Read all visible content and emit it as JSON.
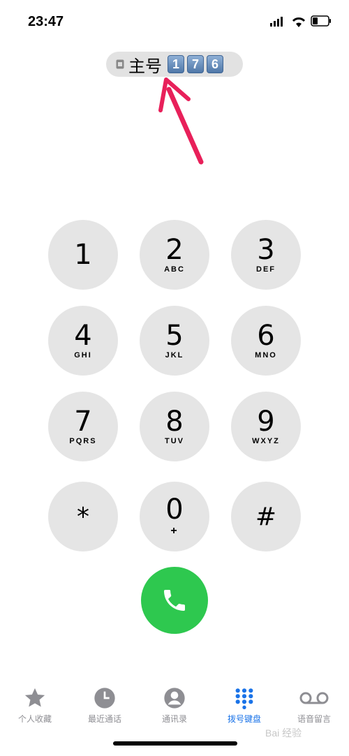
{
  "status": {
    "time": "23:47"
  },
  "sim": {
    "label": "主号",
    "digits": [
      "1",
      "7",
      "6"
    ]
  },
  "keypad": {
    "keys": [
      {
        "digit": "1",
        "letters": ""
      },
      {
        "digit": "2",
        "letters": "ABC"
      },
      {
        "digit": "3",
        "letters": "DEF"
      },
      {
        "digit": "4",
        "letters": "GHI"
      },
      {
        "digit": "5",
        "letters": "JKL"
      },
      {
        "digit": "6",
        "letters": "MNO"
      },
      {
        "digit": "7",
        "letters": "PQRS"
      },
      {
        "digit": "8",
        "letters": "TUV"
      },
      {
        "digit": "9",
        "letters": "WXYZ"
      },
      {
        "digit": "*",
        "letters": ""
      },
      {
        "digit": "0",
        "letters": "+"
      },
      {
        "digit": "#",
        "letters": ""
      }
    ]
  },
  "tabs": [
    {
      "label": "个人收藏",
      "icon": "star-icon"
    },
    {
      "label": "最近通话",
      "icon": "clock-icon"
    },
    {
      "label": "通讯录",
      "icon": "contact-icon"
    },
    {
      "label": "拨号键盘",
      "icon": "keypad-icon",
      "active": true
    },
    {
      "label": "语音留言",
      "icon": "voicemail-icon"
    }
  ],
  "colors": {
    "accent": "#1a73e8",
    "call": "#2ec84f",
    "key": "#e5e5e5",
    "arrow": "#e8205a"
  },
  "watermark": "Bai 经验"
}
